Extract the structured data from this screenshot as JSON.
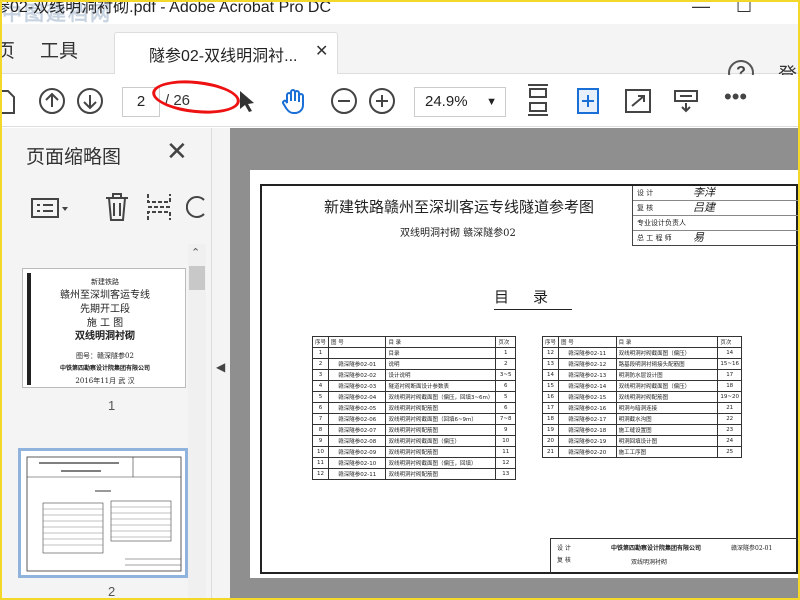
{
  "window": {
    "title": "参02-双线明洞衬砌.pdf - Adobe Acrobat Pro DC",
    "watermark": "中图建档网"
  },
  "tabs": {
    "home": "页",
    "tools": "工具",
    "doc": "隧参02-双线明洞衬...",
    "login": "登"
  },
  "toolbar": {
    "current_page": "2",
    "total_pages": "/ 26",
    "zoom": "24.9%"
  },
  "sidebar": {
    "title": "页面缩略图",
    "thumb1_lines": [
      "新建铁路",
      "赣州至深圳客运专线",
      "先期开工段",
      "施 工 图",
      "双线明洞衬砌",
      "图号：赣深隧参02",
      "中铁第四勘察设计院集团有限公司",
      "2016年11月   武  汉"
    ],
    "thumb1_label": "1",
    "thumb2_label": "2"
  },
  "document": {
    "title": "新建铁路赣州至深圳客运专线隧道参考图",
    "subtitle": "双线明洞衬砌      赣深隧参02",
    "signatures": [
      {
        "role": "设    计",
        "name": "李洋"
      },
      {
        "role": "复    核",
        "name": "吕建"
      },
      {
        "role": "专业设计负责人",
        "name": ""
      },
      {
        "role": "总 工 程 师",
        "name": "易"
      }
    ],
    "toc_heading": "目录",
    "toc_left_header": [
      "序号",
      "图  号",
      "目    录",
      "页次"
    ],
    "toc_left": [
      [
        "1",
        "",
        "目录",
        "1"
      ],
      [
        "2",
        "赣深隧参02-01",
        "说明",
        "2"
      ],
      [
        "3",
        "赣深隧参02-02",
        "设计说明",
        "3~5"
      ],
      [
        "4",
        "赣深隧参02-03",
        "隧道衬砌断面设计参数表",
        "6"
      ],
      [
        "5",
        "赣深隧参02-04",
        "双线明洞衬砌截面图（偏压，回填3~6m）",
        "5"
      ],
      [
        "6",
        "赣深隧参02-05",
        "双线明洞衬砌配筋图",
        "6"
      ],
      [
        "7",
        "赣深隧参02-06",
        "双线明洞衬砌截面图（回填6~9m）",
        "7~8"
      ],
      [
        "8",
        "赣深隧参02-07",
        "双线明洞衬砌配筋图",
        "9"
      ],
      [
        "9",
        "赣深隧参02-08",
        "双线明洞衬砌截面图（偏压）",
        "10"
      ],
      [
        "10",
        "赣深隧参02-09",
        "双线明洞衬砌配筋图",
        "11"
      ],
      [
        "11",
        "赣深隧参02-10",
        "双线明洞衬砌截面图（偏压，回填）",
        "12"
      ],
      [
        "12",
        "赣深隧参02-11",
        "双线明洞衬砌配筋图",
        "13"
      ]
    ],
    "toc_right_header": [
      "序号",
      "图  号",
      "目    录",
      "页次"
    ],
    "toc_right": [
      [
        "12",
        "赣深隧参02-11",
        "双线明洞衬砌截面图（偏压）",
        "14"
      ],
      [
        "13",
        "赣深隧参02-12",
        "路基段明洞衬砌接头配筋图",
        "15~16"
      ],
      [
        "14",
        "赣深隧参02-13",
        "明洞防水层设计图",
        "17"
      ],
      [
        "15",
        "赣深隧参02-14",
        "双线明洞衬砌截面图（偏压）",
        "18"
      ],
      [
        "16",
        "赣深隧参02-15",
        "双线明洞衬砌配筋图",
        "19~20"
      ],
      [
        "17",
        "赣深隧参02-16",
        "明洞与暗洞连接",
        "21"
      ],
      [
        "18",
        "赣深隧参02-17",
        "明洞截水沟图",
        "22"
      ],
      [
        "19",
        "赣深隧参02-18",
        "施工缝设置图",
        "23"
      ],
      [
        "20",
        "赣深隧参02-19",
        "明洞回填设计图",
        "24"
      ],
      [
        "21",
        "赣深隧参02-20",
        "施工工序图",
        "25"
      ]
    ],
    "footer_company": "中铁第四勘察设计院集团有限公司",
    "footer_title": "双线明洞衬砌",
    "footer_drawing_no": "赣深隧参02-01"
  }
}
